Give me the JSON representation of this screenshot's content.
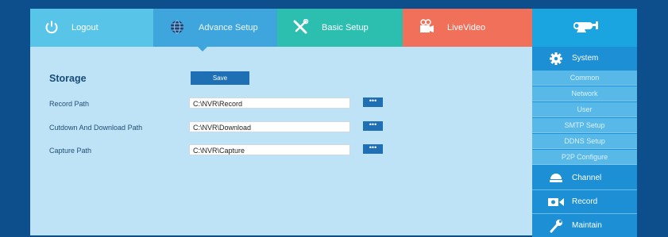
{
  "nav": {
    "logout": "Logout",
    "advance_setup": "Advance Setup",
    "basic_setup": "Basic Setup",
    "live_video": "LiveVideo"
  },
  "storage": {
    "title": "Storage",
    "save_label": "Save",
    "rows": [
      {
        "label": "Record  Path",
        "value": "C:\\NVR\\Record",
        "button": "•••"
      },
      {
        "label": "Cutdown And Download Path",
        "value": "C:\\NVR\\Download",
        "button": "•••"
      },
      {
        "label": "Capture Path",
        "value": "C:\\NVR\\Capture",
        "button": "•••"
      }
    ]
  },
  "sidebar": {
    "system": "System",
    "sub_items": [
      "Common",
      "Network",
      "User",
      "SMTP Setup",
      "DDNS Setup",
      "P2P Configure"
    ],
    "channel": "Channel",
    "record": "Record",
    "maintain": "Maintain"
  },
  "icons": {
    "logout": "power-icon",
    "advance_setup": "globe-icon",
    "basic_setup": "tools-icon",
    "live_video": "camera-icon",
    "logo": "cctv-camera-icon",
    "system": "gear-icon",
    "channel": "dome-camera-icon",
    "record": "video-record-icon",
    "maintain": "wrench-icon"
  },
  "colors": {
    "logout_tab": "#58c5e8",
    "advance_tab": "#3fa6dd",
    "basic_tab": "#2cbfb0",
    "live_tab": "#f0705a",
    "content_bg": "#bfe3f6",
    "button": "#1f6fb4"
  }
}
